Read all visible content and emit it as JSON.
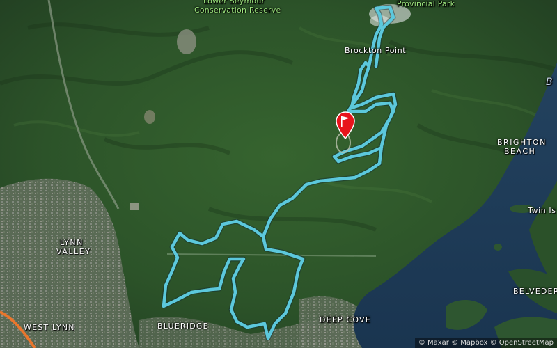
{
  "map": {
    "labels": {
      "provincial_park": "Provincial Park",
      "reserve_line1": "Lower Seymour",
      "reserve_line2": "Conservation Reserve",
      "brockton_point": "Brockton Point",
      "brighton_line1": "BRIGHTON",
      "brighton_line2": "BEACH",
      "twin_islands": "Twin Is",
      "lynn_line1": "LYNN",
      "lynn_line2": "VALLEY",
      "west_lynn": "WEST LYNN",
      "blueridge": "BLUERIDGE",
      "deep_cove": "DEEP COVE",
      "belvedere": "BELVEDER",
      "water_b": "B"
    },
    "attribution": "© Maxar © Mapbox © OpenStreetMap"
  },
  "colors": {
    "route": "#5cc8dc",
    "marker": "#e8141c",
    "water": "#1d3a57",
    "forest": "#2f5a2e",
    "park_label": "#9be37c"
  },
  "icons": {
    "marker": "flag-marker-icon"
  }
}
